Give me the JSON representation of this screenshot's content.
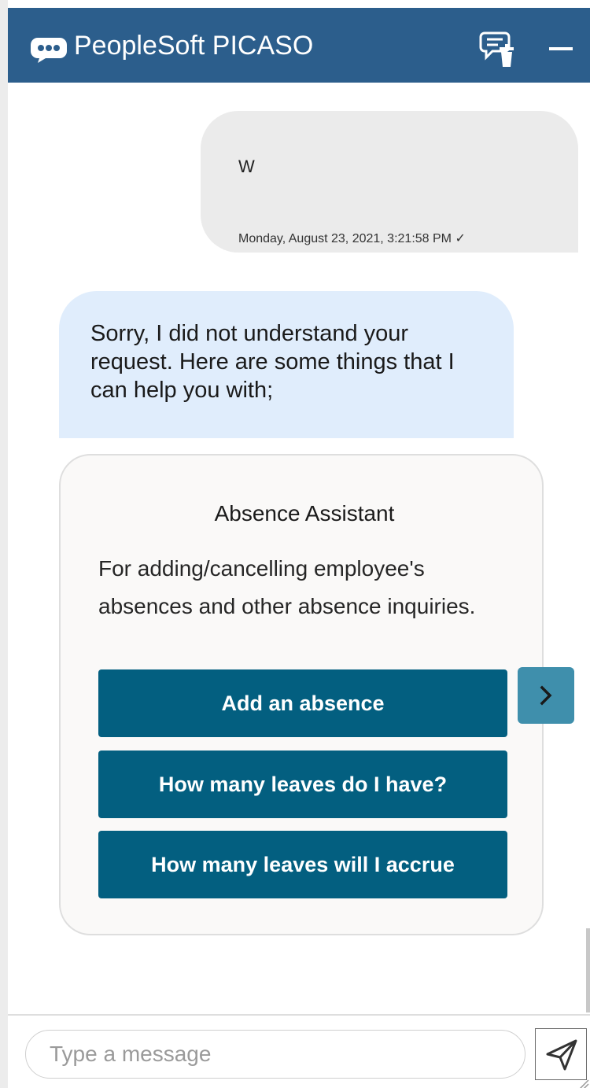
{
  "header": {
    "title": "PeopleSoft PICASO",
    "logo_icon": "chat-bubble-icon",
    "clear_icon": "clear-chat-icon",
    "minimize_icon": "minimize-icon",
    "background": "#2c5e8c"
  },
  "conversation": {
    "user_message": {
      "text": "W",
      "timestamp": "Monday, August 23, 2021, 3:21:58 PM",
      "status_glyph": "✓"
    },
    "bot_message": {
      "text": "Sorry, I did not understand your request. Here are some things that I can help you with;"
    },
    "card": {
      "title": "Absence Assistant",
      "description": "For adding/cancelling employee's absences and other absence inquiries.",
      "actions": [
        "Add an absence",
        "How many leaves do I have?",
        "How many leaves will I accrue"
      ],
      "next_icon": "chevron-right-icon"
    }
  },
  "composer": {
    "placeholder": "Type a message",
    "send_icon": "send-icon"
  },
  "colors": {
    "user_bubble": "#ebebeb",
    "bot_bubble": "#e0edfc",
    "action_button": "#035f80",
    "next_button": "#3f8fac"
  }
}
